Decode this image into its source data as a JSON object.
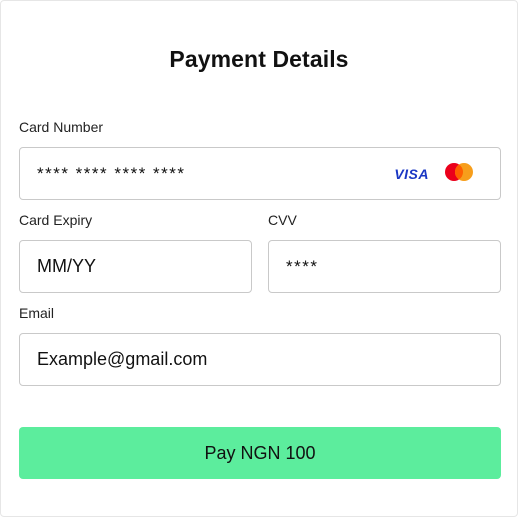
{
  "title": "Payment Details",
  "card_number": {
    "label": "Card Number",
    "value": "**** **** **** ****",
    "brands": [
      "VISA",
      "mastercard-icon"
    ]
  },
  "card_expiry": {
    "label": "Card Expiry",
    "value": "MM/YY"
  },
  "cvv": {
    "label": "CVV",
    "value": "****"
  },
  "email": {
    "label": "Email",
    "value": "Example@gmail.com"
  },
  "pay_button": {
    "label": "Pay NGN 100"
  },
  "colors": {
    "button": "#5ced9d",
    "visa": "#1a37c4",
    "mastercard_red": "#eb001b",
    "mastercard_orange": "#f79e1b"
  }
}
